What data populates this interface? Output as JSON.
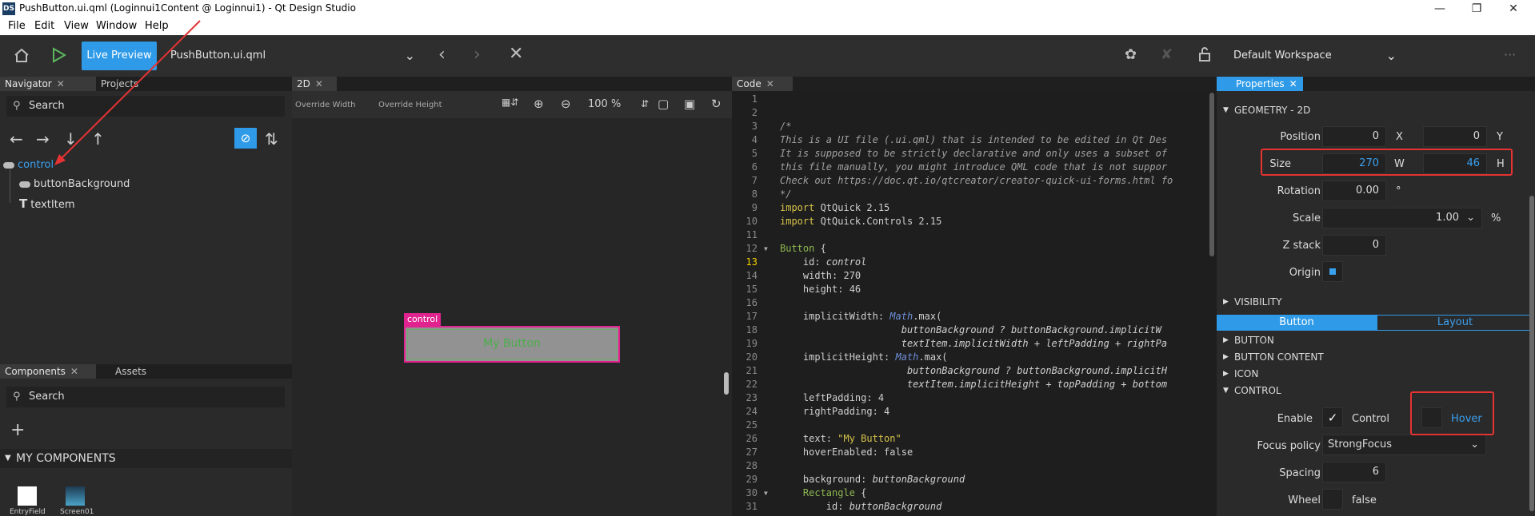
{
  "window": {
    "title": "PushButton.ui.qml (Loginnui1Content @ Loginnui1) - Qt Design Studio",
    "logo": "DS",
    "minimize_icon": "minimize-icon",
    "maximize_icon": "maximize-icon",
    "close_icon": "close-icon"
  },
  "menu": [
    "File",
    "Edit",
    "View",
    "Window",
    "Help"
  ],
  "toolbar": {
    "live_preview": "Live Preview",
    "file": "PushButton.ui.qml",
    "workspace": "Default Workspace"
  },
  "navigator": {
    "tabs": [
      "Navigator",
      "Projects"
    ],
    "search_placeholder": "Search",
    "tree": [
      {
        "label": "control",
        "selected": true,
        "icon": "rectangle-icon"
      },
      {
        "label": "buttonBackground",
        "selected": false,
        "icon": "rectangle-icon"
      },
      {
        "label": "textItem",
        "selected": false,
        "icon": "text-icon"
      }
    ]
  },
  "components": {
    "tabs": [
      "Components",
      "Assets"
    ],
    "search_placeholder": "Search",
    "section": "MY COMPONENTS",
    "items": [
      "EntryField",
      "Screen01"
    ]
  },
  "view2d": {
    "tab": "2D",
    "override_width": "Override Width",
    "override_height": "Override Height",
    "zoom": "100 %",
    "control_label": "control",
    "button_text": "My Button"
  },
  "code": {
    "tab": "Code",
    "current_line": 13
  },
  "properties": {
    "tab": "Properties",
    "geometry_section": "GEOMETRY - 2D",
    "position_label": "Position",
    "position_x": "0",
    "position_y": "0",
    "x_unit": "X",
    "y_unit": "Y",
    "size_label": "Size",
    "size_w": "270",
    "size_h": "46",
    "w_unit": "W",
    "h_unit": "H",
    "rotation_label": "Rotation",
    "rotation": "0.00",
    "rotation_unit": "°",
    "scale_label": "Scale",
    "scale": "1.00",
    "scale_unit": "%",
    "zstack_label": "Z stack",
    "zstack": "0",
    "origin_label": "Origin",
    "visibility_section": "VISIBILITY",
    "subtabs": [
      "Button",
      "Layout"
    ],
    "button_section": "BUTTON",
    "button_content_section": "BUTTON CONTENT",
    "icon_section": "ICON",
    "control_section": "CONTROL",
    "enable_label": "Enable",
    "enable_checkbox_label": "Control",
    "hover_label": "Hover",
    "focus_policy_label": "Focus policy",
    "focus_policy": "StrongFocus",
    "spacing_label": "Spacing",
    "spacing": "6",
    "wheel_label": "Wheel",
    "wheel": "false"
  },
  "colors": {
    "accent": "#2f9be8",
    "selection": "#e0238e",
    "annotation": "#e53333"
  }
}
